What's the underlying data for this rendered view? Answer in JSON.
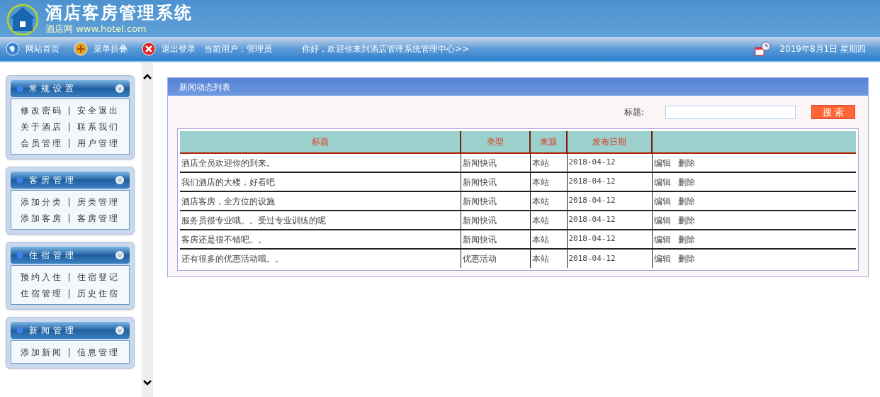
{
  "header": {
    "title": "酒店客房管理系统",
    "subtitle": "酒店网 www.hotel.com"
  },
  "nav": {
    "items": [
      {
        "kind": "home",
        "label": "网站首页"
      },
      {
        "kind": "collapse",
        "label": "菜单折叠"
      },
      {
        "kind": "logout",
        "label": "退出登录"
      }
    ],
    "user_label": "当前用户：",
    "user": "管理员",
    "welcome": "你好，欢迎你来到酒店管理系统管理中心>>",
    "date": "2019年8月1日  星期四"
  },
  "sidebar": {
    "groups": [
      {
        "title": "常规设置",
        "rows": [
          [
            "修改密码",
            "安全退出"
          ],
          [
            "关于酒店",
            "联系我们"
          ],
          [
            "会员管理",
            "用户管理"
          ]
        ]
      },
      {
        "title": "客房管理",
        "rows": [
          [
            "添加分类",
            "房类管理"
          ],
          [
            "添加客房",
            "客房管理"
          ]
        ]
      },
      {
        "title": "住宿管理",
        "rows": [
          [
            "预约入住",
            "住宿登记"
          ],
          [
            "住宿管理",
            "历史住宿"
          ]
        ]
      },
      {
        "title": "新闻管理",
        "rows": [
          [
            "添加新闻",
            "信息管理"
          ]
        ]
      }
    ],
    "separator": "|"
  },
  "panel": {
    "title": "新闻动态列表",
    "search_label": "标题:",
    "search_button": "搜 索",
    "table": {
      "columns": [
        "标题",
        "类型",
        "来源",
        "发布日期"
      ],
      "rows": [
        {
          "title": "酒店全员欢迎你的到来。",
          "type": "新闻快讯",
          "source": "本站",
          "date": "2018-04-12",
          "actions": [
            "编辑",
            "删除"
          ]
        },
        {
          "title": "我们酒店的大楼，好看吧",
          "type": "新闻快讯",
          "source": "本站",
          "date": "2018-04-12",
          "actions": [
            "编辑",
            "删除"
          ]
        },
        {
          "title": "酒店客房，全方位的设施",
          "type": "新闻快讯",
          "source": "本站",
          "date": "2018-04-12",
          "actions": [
            "编辑",
            "删除"
          ]
        },
        {
          "title": "服务员很专业哦。。受过专业训练的呢",
          "type": "新闻快讯",
          "source": "本站",
          "date": "2018-04-12",
          "actions": [
            "编辑",
            "删除"
          ]
        },
        {
          "title": "客房还是很不错吧。。",
          "type": "新闻快讯",
          "source": "本站",
          "date": "2018-04-12",
          "actions": [
            "编辑",
            "删除"
          ]
        },
        {
          "title": "还有很多的优惠活动哦。。",
          "type": "优惠活动",
          "source": "本站",
          "date": "2018-04-12",
          "actions": [
            "编辑",
            "删除"
          ]
        }
      ]
    }
  }
}
